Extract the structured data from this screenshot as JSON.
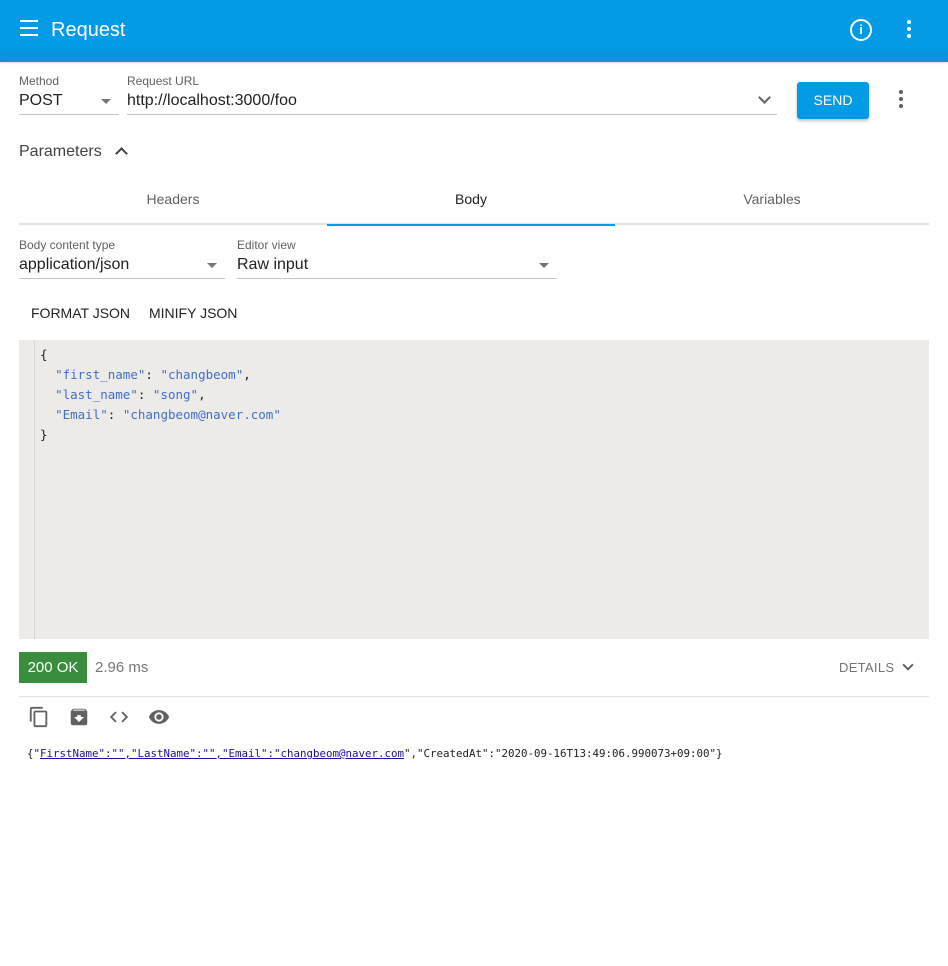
{
  "appbar": {
    "title": "Request",
    "menu_icon": "menu-icon",
    "info_icon": "info-icon",
    "more_icon": "more-vert-icon",
    "color": "#039be5"
  },
  "request": {
    "method_label": "Method",
    "method_value": "POST",
    "url_label": "Request URL",
    "url_value": "http://localhost:3000/foo",
    "send_label": "SEND"
  },
  "parameters": {
    "label": "Parameters",
    "tabs": [
      "Headers",
      "Body",
      "Variables"
    ],
    "active_tab": "Body"
  },
  "body": {
    "content_type_label": "Body content type",
    "content_type_value": "application/json",
    "editor_view_label": "Editor view",
    "editor_view_value": "Raw input",
    "format_label": "FORMAT JSON",
    "minify_label": "MINIFY JSON",
    "json_lines": [
      {
        "key": "\"first_name\"",
        "value": "\"changbeom\"",
        "comma": ","
      },
      {
        "key": "\"last_name\"",
        "value": "\"song\"",
        "comma": ","
      },
      {
        "key": "\"Email\"",
        "value": "\"changbeom@naver.com\"",
        "comma": ""
      }
    ],
    "open_brace": "{",
    "close_brace": "}"
  },
  "response": {
    "status": "200 OK",
    "status_color": "#388e3c",
    "time": "2.96 ms",
    "details_label": "DETAILS",
    "tool_icons": [
      "copy-icon",
      "save-icon",
      "code-icon",
      "preview-icon"
    ],
    "text_prefix": "{\"",
    "link1": "FirstName\":\"\",\"LastName\":\"\",\"Email\":\"changbeom@naver.com",
    "text_suffix": "\",\"CreatedAt\":\"2020-09-16T13:49:06.990073+09:00\"}"
  }
}
